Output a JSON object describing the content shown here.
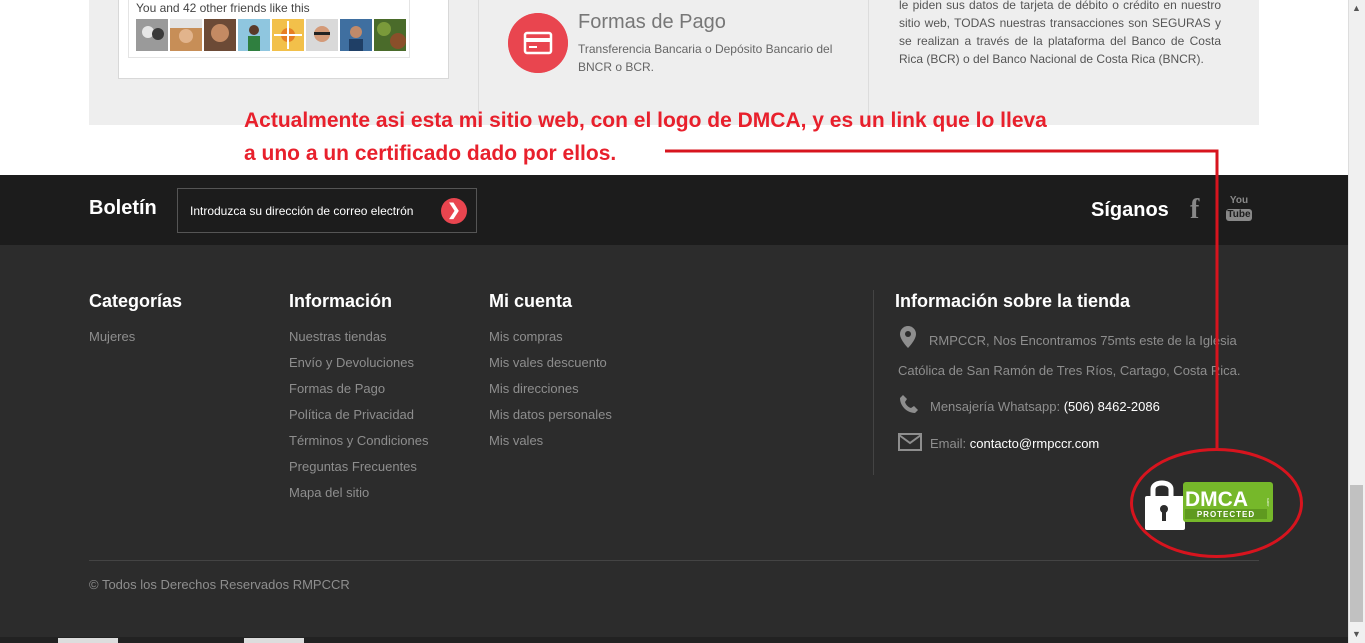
{
  "facebook": {
    "text": "You and 42 other friends like this"
  },
  "payment": {
    "title": "Formas de Pago",
    "description": "Transferencia Bancaria o Depósito Bancario del BNCR o BCR."
  },
  "security": {
    "text": "le piden sus datos de tarjeta de débito o crédito en nuestro sitio web, TODAS nuestras transacciones son SEGURAS y se realizan a través de la plataforma del Banco de Costa Rica (BCR) o del Banco Nacional de Costa Rica (BNCR)."
  },
  "annotation": {
    "line1": "Actualmente asi esta mi sitio web, con el logo de DMCA, y es un link que lo lleva",
    "line2": "a uno a un certificado dado por ellos."
  },
  "newsletter": {
    "label": "Boletín",
    "placeholder": "Introduzca su dirección de correo electrón"
  },
  "social": {
    "label": "Síganos",
    "youtube_you": "You",
    "youtube_tube": "Tube"
  },
  "footer": {
    "categories": {
      "title": "Categorías",
      "items": [
        "Mujeres"
      ]
    },
    "information": {
      "title": "Información",
      "items": [
        "Nuestras tiendas",
        "Envío y Devoluciones",
        "Formas de Pago",
        "Política de Privacidad",
        "Términos y Condiciones",
        "Preguntas Frecuentes",
        "Mapa del sitio"
      ]
    },
    "account": {
      "title": "Mi cuenta",
      "items": [
        "Mis compras",
        "Mis vales descuento",
        "Mis direcciones",
        "Mis datos personales",
        "Mis vales"
      ]
    },
    "store": {
      "title": "Información sobre la tienda",
      "address_line1": "RMPCCR, Nos Encontramos 75mts este de la Iglesia",
      "address_line2": "Católica de San Ramón de Tres Ríos, Cartago, Costa Rica.",
      "whatsapp_label": "Mensajería Whatsapp:",
      "whatsapp_value": "(506) 8462-2086",
      "email_label": "Email:",
      "email_value": "contacto@rmpccr.com"
    },
    "dmca": {
      "brand": "DMCA",
      "status": "PROTECTED",
      "side": ".com"
    },
    "copyright": "© Todos los Derechos Reservados RMPCCR"
  },
  "colors": {
    "accent": "#e9454f",
    "annotation": "#e8202c",
    "footer_bg": "#2c2c2c",
    "newsletter_bg": "#1c1c1c",
    "dmca_green": "#76b82a"
  }
}
